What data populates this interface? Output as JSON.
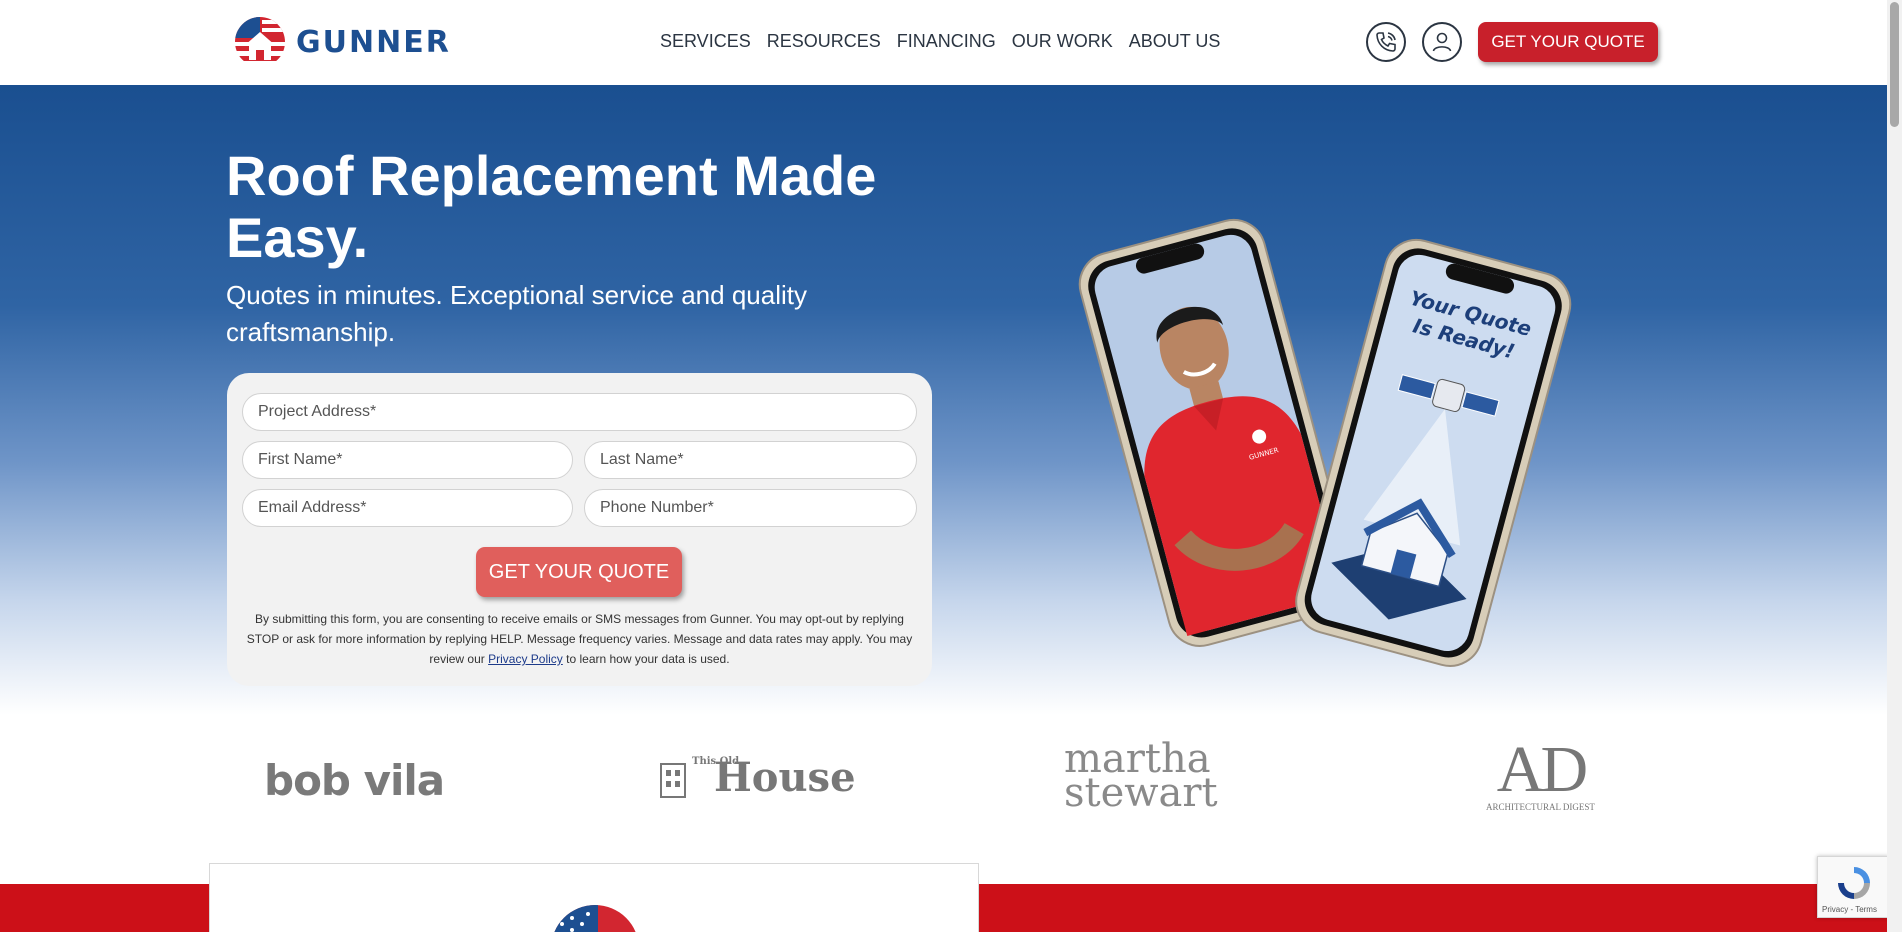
{
  "brand": {
    "name": "GUNNER",
    "primary_color": "#1d4f91",
    "accent_color": "#c8202b"
  },
  "nav": {
    "items": [
      {
        "label": "SERVICES"
      },
      {
        "label": "RESOURCES"
      },
      {
        "label": "FINANCING"
      },
      {
        "label": "OUR WORK"
      },
      {
        "label": "ABOUT US"
      }
    ],
    "phone_icon": "phone-icon",
    "account_icon": "user-icon",
    "cta_label": "GET YOUR QUOTE"
  },
  "hero": {
    "title": "Roof Replacement Made Easy.",
    "subtitle": "Quotes in minutes. Exceptional service and quality craftsmanship."
  },
  "form": {
    "address_placeholder": "Project Address*",
    "first_name_placeholder": "First Name*",
    "last_name_placeholder": "Last Name*",
    "email_placeholder": "Email Address*",
    "phone_placeholder": "Phone Number*",
    "submit_label": "GET YOUR QUOTE",
    "disclaimer_before": "By submitting this form, you are consenting to receive emails or SMS messages from Gunner. You may opt-out by replying STOP or ask for more information by replying HELP. Message frequency varies. Message and data rates may apply. You may review our ",
    "privacy_link": "Privacy Policy",
    "disclaimer_after": " to learn how your data is used."
  },
  "phones": {
    "quote_text_line1": "Your Quote",
    "quote_text_line2": "Is Ready!",
    "shirt_logo": "GUNNER"
  },
  "press": {
    "bobvila": "bob vila",
    "this_old": "This Old",
    "house": "House",
    "martha_line1": "martha",
    "martha_line2": "stewart",
    "ad_letters": "AD",
    "ad_sub": "ARCHITECTURAL DIGEST"
  },
  "recaptcha": {
    "text": "Privacy - Terms"
  }
}
